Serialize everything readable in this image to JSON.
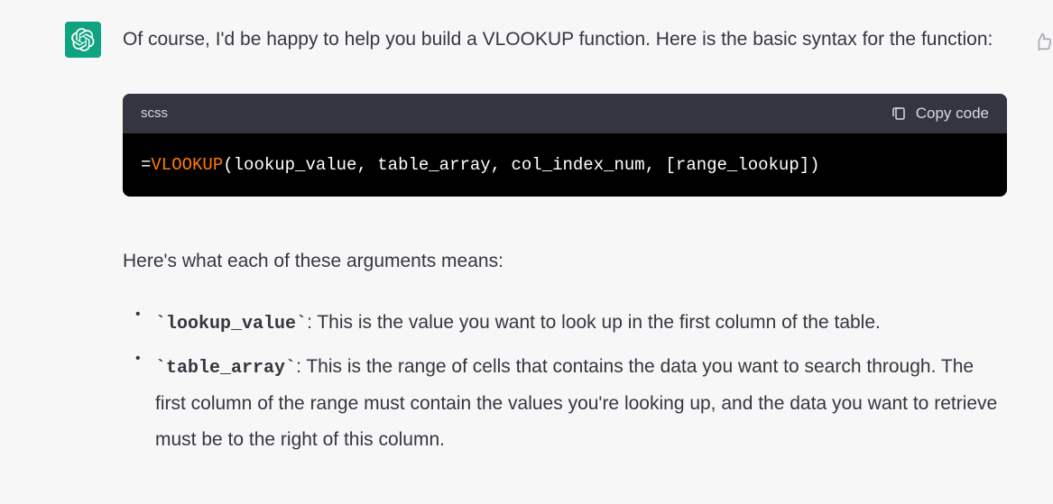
{
  "message": {
    "intro": "Of course, I'd be happy to help you build a VLOOKUP function. Here is the basic syntax for the function:",
    "code": {
      "language": "scss",
      "copy_label": "Copy code",
      "equals": "=",
      "function": "VLOOKUP",
      "args": "(lookup_value, table_array, col_index_num, [range_lookup])"
    },
    "explain": "Here's what each of these arguments means:",
    "bullets": [
      {
        "term": "lookup_value",
        "desc": ": This is the value you want to look up in the first column of the table."
      },
      {
        "term": "table_array",
        "desc": ": This is the range of cells that contains the data you want to search through. The first column of the range must contain the values you're looking up, and the data you want to retrieve must be to the right of this column."
      }
    ]
  }
}
